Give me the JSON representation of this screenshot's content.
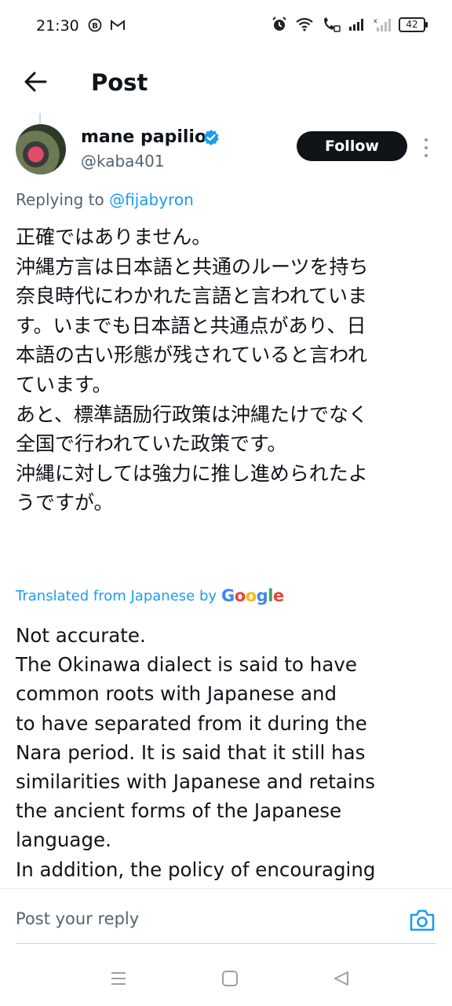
{
  "status_bar": {
    "time": "21:30",
    "battery": "42",
    "left_icons": [
      "b-circle-icon",
      "gmail-icon"
    ],
    "right_icons": [
      "alarm-icon",
      "wifi-icon",
      "wifi-call-icon",
      "signal-icon",
      "signal-weak-icon",
      "battery-icon"
    ]
  },
  "header": {
    "title": "Post",
    "back_icon": "arrow-left-icon"
  },
  "post": {
    "author_name": "mane papilio",
    "author_handle": "@kaba401",
    "verified_icon": "verified-badge-icon",
    "follow_label": "Follow",
    "more_icon": "more-vertical-icon",
    "replying_prefix": "Replying to",
    "replying_to": "@fijabyron",
    "jp_lines": [
      "正確ではありません。",
      "沖縄方言は日本語と共通のルーツを持ち",
      "奈良時代にわかれた言語と言われていま",
      "す。いまでも日本語と共通点があり、日",
      "本語の古い形態が残されていると言われ",
      "ています。",
      "あと、標準語励行政策は沖縄たけでなく",
      "全国で行われていた政策です。",
      "沖縄に対しては強力に推し進められたよ",
      "うですが。"
    ],
    "translated_label": "Translated from Japanese by",
    "translated_brand": "Google",
    "en_lines": [
      "Not accurate.",
      "The Okinawa dialect is said to have",
      "common roots with Japanese and",
      "to have separated from it during the",
      "Nara period. It is said that it still has",
      "similarities with Japanese and retains",
      "the ancient forms of the Japanese",
      "language.",
      "In addition, the policy of encouraging"
    ]
  },
  "reply": {
    "placeholder": "Post your reply",
    "camera_icon": "camera-icon"
  },
  "nav": {
    "icons": [
      "menu-icon",
      "home-square-icon",
      "back-triangle-icon"
    ]
  },
  "colors": {
    "accent": "#1d9bf0",
    "text": "#0f1419",
    "secondary_text": "#536471",
    "button_bg": "#0f1419"
  }
}
